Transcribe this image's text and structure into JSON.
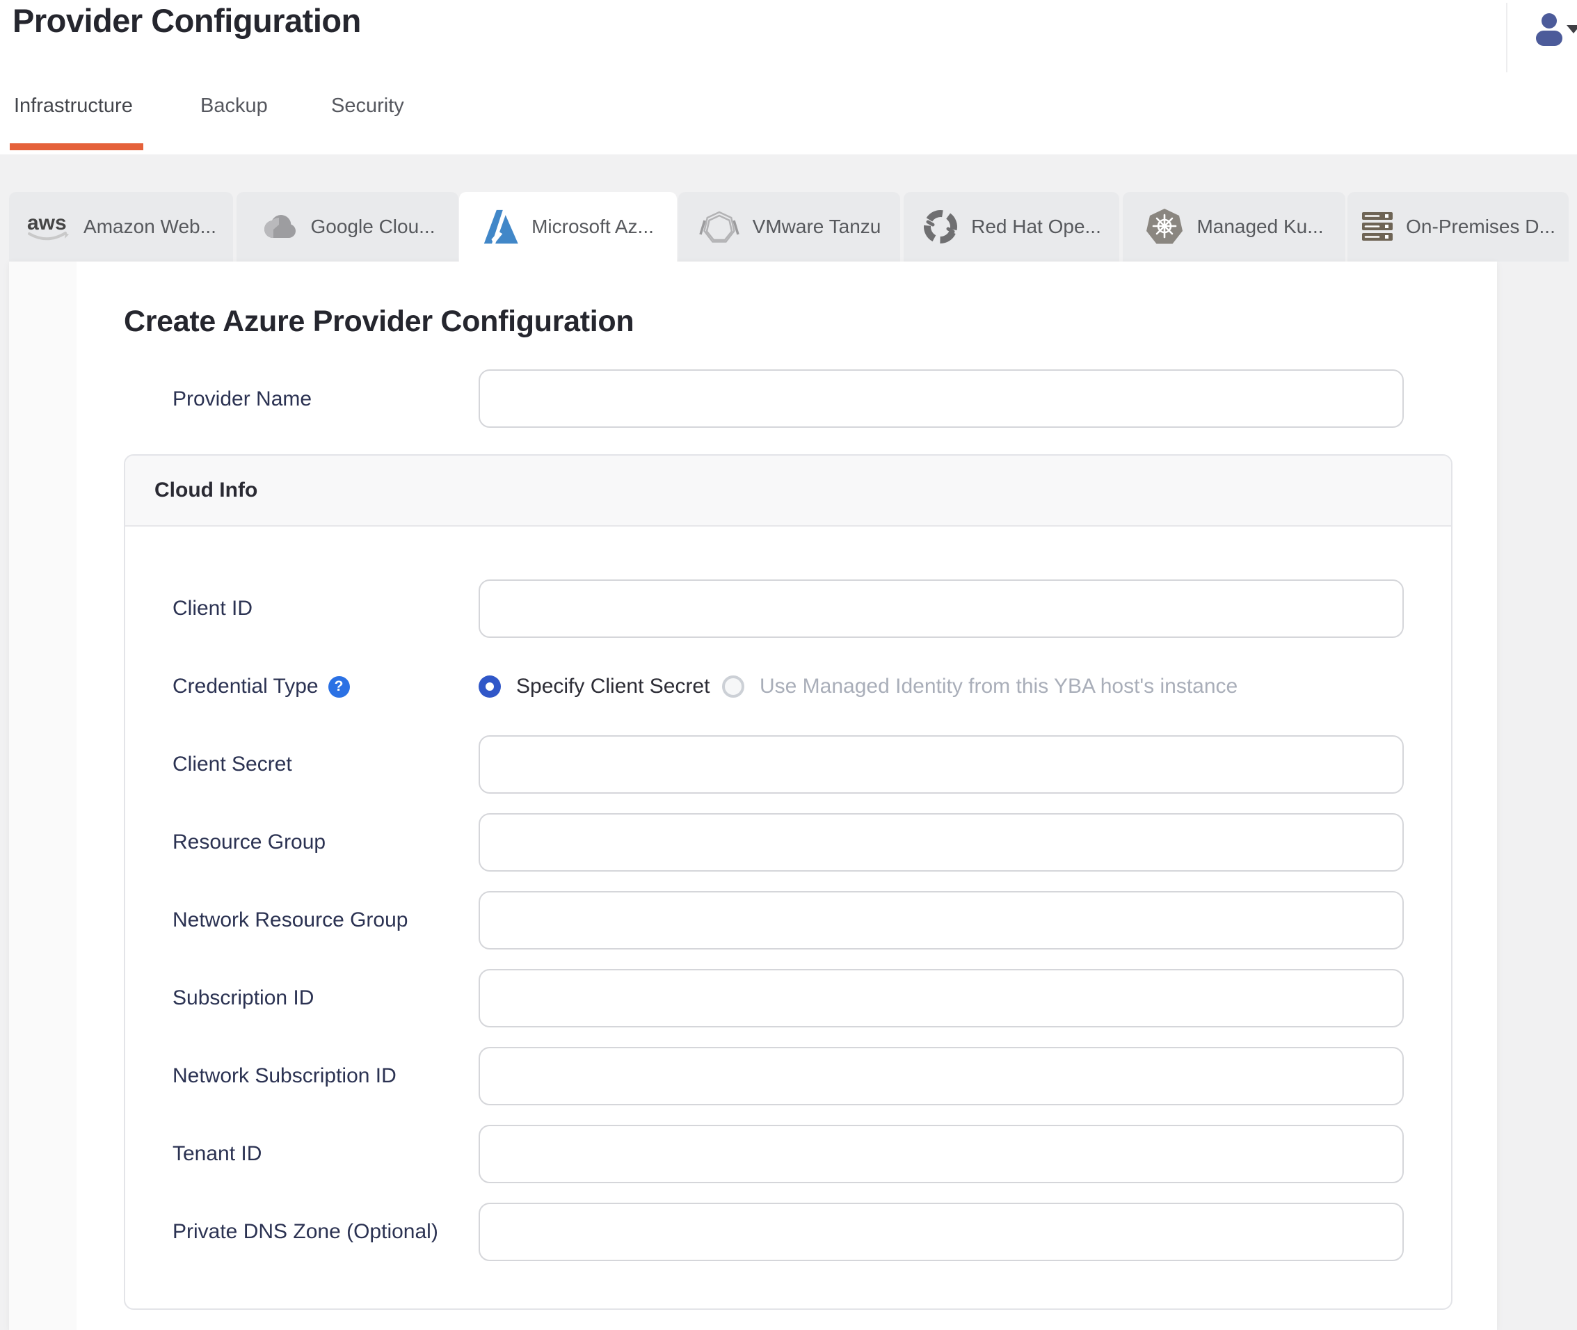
{
  "header": {
    "title": "Provider Configuration"
  },
  "nav": {
    "tabs": [
      {
        "label": "Infrastructure",
        "active": true
      },
      {
        "label": "Backup",
        "active": false
      },
      {
        "label": "Security",
        "active": false
      }
    ]
  },
  "provider_tabs": [
    {
      "label": "Amazon Web...",
      "icon": "aws-icon",
      "active": false
    },
    {
      "label": "Google Clou...",
      "icon": "google-cloud-icon",
      "active": false
    },
    {
      "label": "Microsoft Az...",
      "icon": "azure-icon",
      "active": true
    },
    {
      "label": "VMware Tanzu",
      "icon": "vmware-tanzu-icon",
      "active": false
    },
    {
      "label": "Red Hat Ope...",
      "icon": "redhat-openshift-icon",
      "active": false
    },
    {
      "label": "Managed Ku...",
      "icon": "kubernetes-icon",
      "active": false
    },
    {
      "label": "On-Premises D...",
      "icon": "on-premises-server-icon",
      "active": false
    }
  ],
  "form": {
    "heading": "Create Azure Provider Configuration",
    "provider_name": {
      "label": "Provider Name",
      "value": "",
      "placeholder": ""
    },
    "cloud_info": {
      "title": "Cloud Info",
      "rows": [
        {
          "label": "Client ID",
          "value": ""
        },
        {
          "label": "Credential Type"
        },
        {
          "label": "Client Secret",
          "value": ""
        },
        {
          "label": "Resource Group",
          "value": ""
        },
        {
          "label": "Network Resource Group",
          "value": ""
        },
        {
          "label": "Subscription ID",
          "value": ""
        },
        {
          "label": "Network Subscription ID",
          "value": ""
        },
        {
          "label": "Tenant ID",
          "value": ""
        },
        {
          "label": "Private DNS Zone (Optional)",
          "value": ""
        }
      ],
      "credential_options": [
        {
          "label": "Specify Client Secret",
          "selected": true,
          "enabled": true
        },
        {
          "label": "Use Managed Identity from this YBA host's instance",
          "selected": false,
          "enabled": false
        }
      ],
      "help_glyph": "?"
    }
  },
  "colors": {
    "accent_orange": "#e5613a",
    "radio_selected_blue": "#3057c8",
    "help_icon_blue": "#2b71e4",
    "azure_brand_blue": "#4187c8"
  }
}
